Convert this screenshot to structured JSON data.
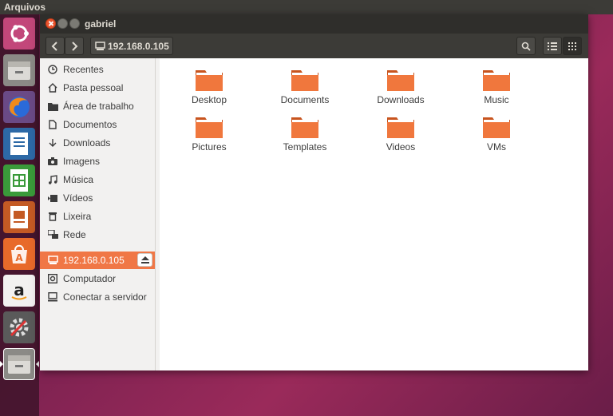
{
  "top_panel": {
    "title": "Arquivos"
  },
  "launcher": {
    "items": [
      {
        "name": "ubuntu-dash-icon"
      },
      {
        "name": "files-icon"
      },
      {
        "name": "firefox-icon"
      },
      {
        "name": "libreoffice-writer-icon"
      },
      {
        "name": "libreoffice-calc-icon"
      },
      {
        "name": "libreoffice-impress-icon"
      },
      {
        "name": "software-center-icon"
      },
      {
        "name": "amazon-icon"
      },
      {
        "name": "system-settings-icon"
      },
      {
        "name": "files-active-icon"
      }
    ]
  },
  "window": {
    "title": "gabriel",
    "path": "192.168.0.105"
  },
  "sidebar": {
    "items": [
      {
        "label": "Recentes",
        "icon": "clock-icon"
      },
      {
        "label": "Pasta pessoal",
        "icon": "home-icon"
      },
      {
        "label": "Área de trabalho",
        "icon": "folder-icon"
      },
      {
        "label": "Documentos",
        "icon": "document-icon"
      },
      {
        "label": "Downloads",
        "icon": "download-icon"
      },
      {
        "label": "Imagens",
        "icon": "camera-icon"
      },
      {
        "label": "Música",
        "icon": "music-icon"
      },
      {
        "label": "Vídeos",
        "icon": "video-icon"
      },
      {
        "label": "Lixeira",
        "icon": "trash-icon"
      },
      {
        "label": "Rede",
        "icon": "network-icon"
      }
    ],
    "network": [
      {
        "label": "192.168.0.105",
        "icon": "network-drive-icon",
        "active": true
      },
      {
        "label": "Computador",
        "icon": "computer-icon"
      },
      {
        "label": "Conectar a servidor",
        "icon": "server-icon"
      }
    ]
  },
  "files": [
    {
      "name": "Desktop"
    },
    {
      "name": "Documents"
    },
    {
      "name": "Downloads"
    },
    {
      "name": "Music"
    },
    {
      "name": "Pictures"
    },
    {
      "name": "Templates"
    },
    {
      "name": "Videos"
    },
    {
      "name": "VMs"
    }
  ],
  "colors": {
    "accent": "#f07746",
    "folder": "#f0773d"
  }
}
